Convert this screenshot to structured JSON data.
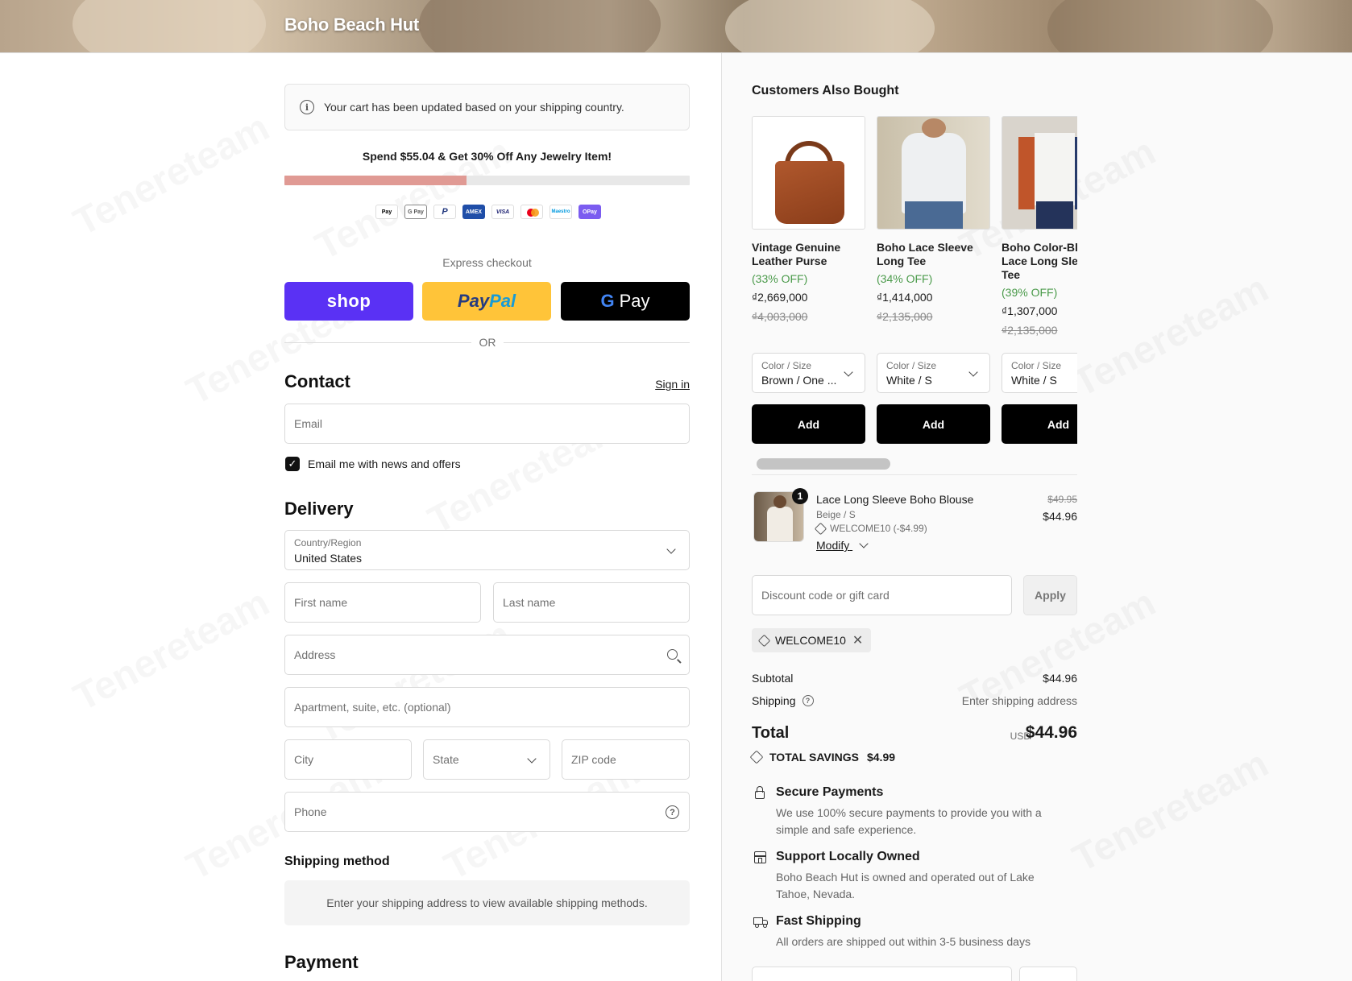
{
  "store": {
    "name": "Boho Beach Hut"
  },
  "notice": {
    "text": "Your cart has been updated based on your shipping country."
  },
  "promo": {
    "text": "Spend $55.04 & Get 30% Off Any Jewelry Item!",
    "progress": 0.45
  },
  "payment_icons": [
    {
      "label": "Pay",
      "icon": "apple-pay-icon"
    },
    {
      "label": "G Pay",
      "icon": "google-pay-icon"
    },
    {
      "label": "P",
      "icon": "paypal-icon"
    },
    {
      "label": "AMEX",
      "icon": "amex-icon"
    },
    {
      "label": "VISA",
      "icon": "visa-icon"
    },
    {
      "label": "",
      "icon": "mastercard-icon"
    },
    {
      "label": "Maestro",
      "icon": "maestro-icon"
    },
    {
      "label": "OPay",
      "icon": "opay-icon"
    }
  ],
  "express": {
    "label": "Express checkout",
    "shop": "shop",
    "paypal_a": "Pay",
    "paypal_b": "Pal",
    "gpay_g": "G",
    "gpay_text": "Pay",
    "or": "OR"
  },
  "contact": {
    "heading": "Contact",
    "signin": "Sign in",
    "email_placeholder": "Email",
    "newsletter_label": "Email me with news and offers",
    "newsletter_checked": true
  },
  "delivery": {
    "heading": "Delivery",
    "country_label": "Country/Region",
    "country_value": "United States",
    "first_name": "First name",
    "last_name": "Last name",
    "address": "Address",
    "apartment": "Apartment, suite, etc. (optional)",
    "city": "City",
    "state": "State",
    "zip": "ZIP code",
    "phone": "Phone"
  },
  "shipping": {
    "heading": "Shipping method",
    "empty": "Enter your shipping address to view available shipping methods."
  },
  "payment": {
    "heading": "Payment"
  },
  "upsell": {
    "heading": "Customers Also Bought",
    "products": [
      {
        "name": "Vintage Genuine Leather Purse",
        "off": "(33% OFF)",
        "price": "₫2,669,000",
        "compare": "₫4,003,000",
        "variant_label": "Color / Size",
        "variant_value": "Brown / One ...",
        "add": "Add"
      },
      {
        "name": "Boho Lace Sleeve Long Tee",
        "off": "(34% OFF)",
        "price": "₫1,414,000",
        "compare": "₫2,135,000",
        "variant_label": "Color / Size",
        "variant_value": "White / S",
        "add": "Add"
      },
      {
        "name": "Boho Color-Block Lace Long Sleeve Tee",
        "off": "(39% OFF)",
        "price": "₫1,307,000",
        "compare": "₫2,135,000",
        "variant_label": "Color / Size",
        "variant_value": "White / S",
        "add": "Add"
      }
    ]
  },
  "cart": {
    "item": {
      "qty": "1",
      "name": "Lace Long Sleeve Boho Blouse",
      "variant": "Beige / S",
      "discount": "WELCOME10 (-$4.99)",
      "modify": "Modify",
      "compare": "$49.95",
      "price": "$44.96"
    },
    "discount_placeholder": "Discount code or gift card",
    "apply": "Apply",
    "applied_code": "WELCOME10"
  },
  "summary": {
    "subtotal_label": "Subtotal",
    "subtotal": "$44.96",
    "shipping_label": "Shipping",
    "shipping": "Enter shipping address",
    "total_label": "Total",
    "currency": "USD",
    "total": "$44.96",
    "savings_label": "TOTAL SAVINGS",
    "savings": "$4.99"
  },
  "features": [
    {
      "title": "Secure Payments",
      "desc": "We use 100% secure payments to provide you with a simple and safe experience.",
      "icon": "lock-icon"
    },
    {
      "title": "Support Locally Owned",
      "desc": "Boho Beach Hut is owned and operated out of Lake Tahoe, Nevada.",
      "icon": "store-icon"
    },
    {
      "title": "Fast Shipping",
      "desc": "All orders are shipped out within 3-5 business days",
      "icon": "truck-icon"
    }
  ],
  "colors": {
    "shop": "#5a31f4",
    "paypal": "#ffc439",
    "progress_fill": "#e09a94",
    "savings_green": "#4a9a4a"
  }
}
